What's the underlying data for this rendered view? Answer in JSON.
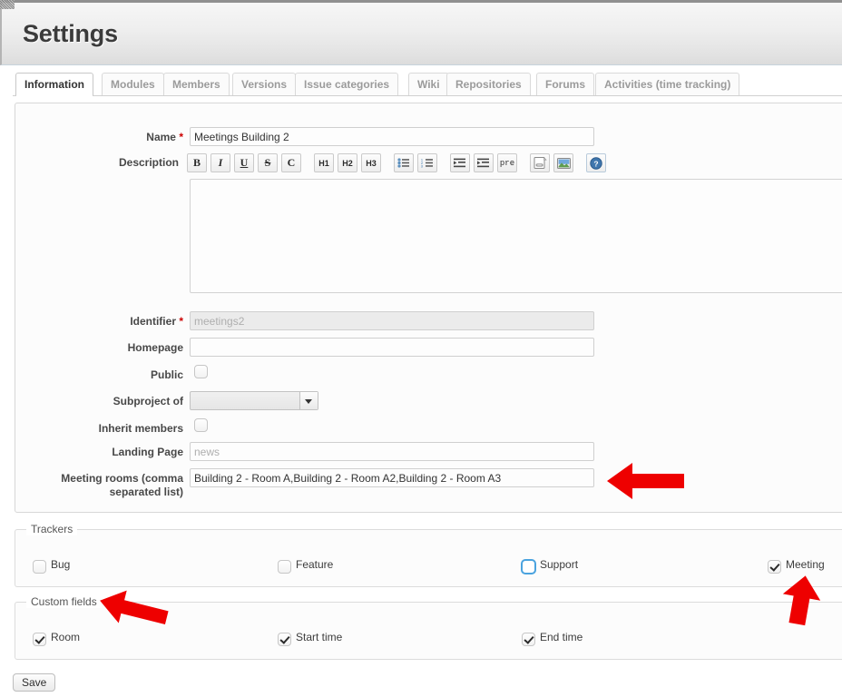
{
  "header": {
    "title": "Settings"
  },
  "tabs": [
    {
      "label": "Information",
      "active": true
    },
    {
      "label": "Modules",
      "active": false
    },
    {
      "label": "Members",
      "active": false
    },
    {
      "label": "Versions",
      "active": false
    },
    {
      "label": "Issue categories",
      "active": false
    },
    {
      "label": "Wiki",
      "active": false
    },
    {
      "label": "Repositories",
      "active": false
    },
    {
      "label": "Forums",
      "active": false
    },
    {
      "label": "Activities (time tracking)",
      "active": false
    }
  ],
  "form": {
    "name": {
      "label": "Name",
      "required_mark": "*",
      "value": "Meetings Building 2"
    },
    "description": {
      "label": "Description",
      "value": ""
    },
    "identifier": {
      "label": "Identifier",
      "required_mark": "*",
      "value": "",
      "placeholder": "meetings2"
    },
    "homepage": {
      "label": "Homepage",
      "value": "",
      "placeholder": ""
    },
    "public": {
      "label": "Public",
      "checked": false
    },
    "subproject_of": {
      "label": "Subproject of",
      "value": ""
    },
    "inherit_members": {
      "label": "Inherit members",
      "checked": false
    },
    "landing_page": {
      "label": "Landing Page",
      "value": "",
      "placeholder": "news"
    },
    "meeting_rooms": {
      "label_line1": "Meeting rooms (comma",
      "label_line2": "separated list)",
      "value": "Building 2 - Room A,Building 2 - Room A2,Building 2 - Room A3"
    }
  },
  "editor_toolbar": [
    {
      "name": "bold-icon",
      "glyph": "B"
    },
    {
      "name": "italic-icon",
      "glyph": "I"
    },
    {
      "name": "underline-icon",
      "glyph": "U"
    },
    {
      "name": "strikethrough-icon",
      "glyph": "S"
    },
    {
      "name": "code-icon",
      "glyph": "C"
    },
    {
      "name": "heading-1-icon",
      "glyph": "H1"
    },
    {
      "name": "heading-2-icon",
      "glyph": "H2"
    },
    {
      "name": "heading-3-icon",
      "glyph": "H3"
    },
    {
      "name": "unordered-list-icon",
      "glyph": ""
    },
    {
      "name": "ordered-list-icon",
      "glyph": ""
    },
    {
      "name": "outdent-icon",
      "glyph": ""
    },
    {
      "name": "indent-icon",
      "glyph": ""
    },
    {
      "name": "preformatted-icon",
      "glyph": "pre"
    },
    {
      "name": "link-icon",
      "glyph": ""
    },
    {
      "name": "image-icon",
      "glyph": ""
    },
    {
      "name": "help-icon",
      "glyph": "?"
    }
  ],
  "trackers": {
    "legend": "Trackers",
    "items": [
      {
        "label": "Bug",
        "checked": false,
        "focused": false
      },
      {
        "label": "Feature",
        "checked": false,
        "focused": false
      },
      {
        "label": "Support",
        "checked": false,
        "focused": true
      },
      {
        "label": "Meeting",
        "checked": true,
        "focused": false
      }
    ]
  },
  "custom_fields": {
    "legend": "Custom fields",
    "items": [
      {
        "label": "Room",
        "checked": true
      },
      {
        "label": "Start time",
        "checked": true
      },
      {
        "label": "End time",
        "checked": true
      }
    ]
  },
  "actions": {
    "save_label": "Save"
  },
  "annotations": {
    "color": "#ee0000",
    "arrows": [
      {
        "name": "annotation-arrow-meeting-rooms",
        "direction": "left"
      },
      {
        "name": "annotation-arrow-custom-fields",
        "direction": "left"
      },
      {
        "name": "annotation-arrow-meeting-tracker",
        "direction": "up"
      }
    ]
  }
}
